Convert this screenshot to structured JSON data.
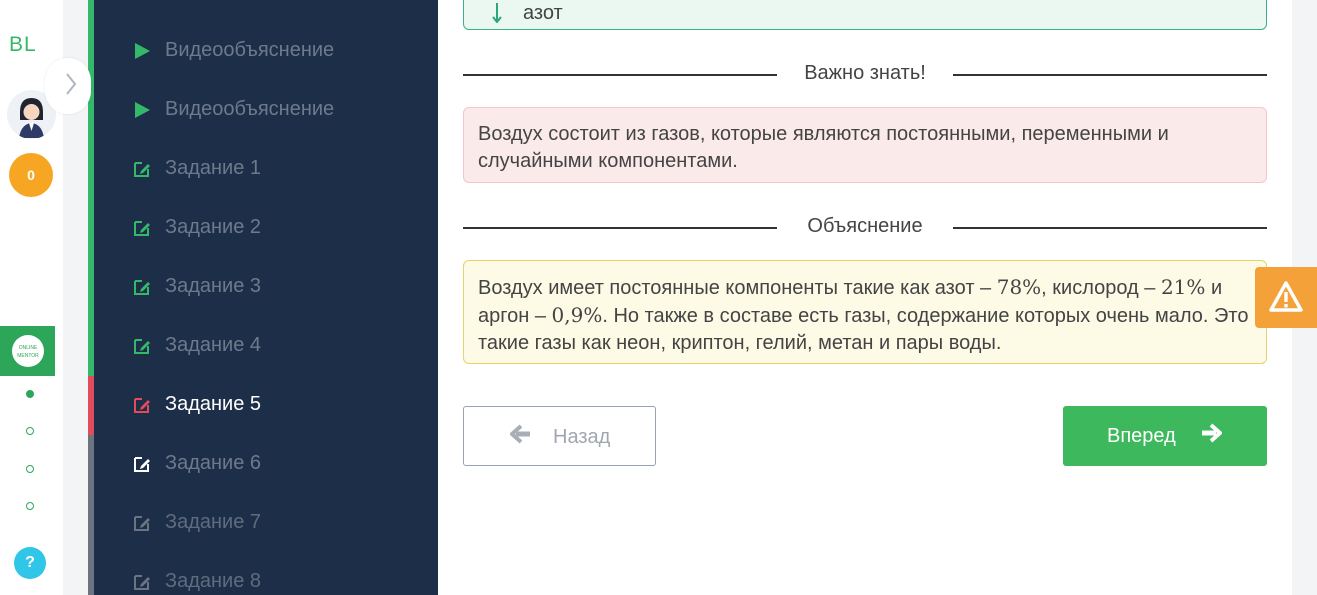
{
  "rail": {
    "logo": "BL",
    "coins": "0",
    "online_badge": "ONLINE MENTOR",
    "help": "?"
  },
  "sidebar": {
    "items": [
      {
        "label": "Видеообъяснение",
        "type": "video",
        "state": "done"
      },
      {
        "label": "Видеообъяснение",
        "type": "video",
        "state": "done"
      },
      {
        "label": "Задание 1",
        "type": "task",
        "state": "done"
      },
      {
        "label": "Задание 2",
        "type": "task",
        "state": "done"
      },
      {
        "label": "Задание 3",
        "type": "task",
        "state": "done"
      },
      {
        "label": "Задание 4",
        "type": "task",
        "state": "done"
      },
      {
        "label": "Задание 5",
        "type": "task",
        "state": "active"
      },
      {
        "label": "Задание 6",
        "type": "task",
        "state": "current"
      },
      {
        "label": "Задание 7",
        "type": "task",
        "state": "locked"
      },
      {
        "label": "Задание 8",
        "type": "task",
        "state": "locked"
      }
    ]
  },
  "main": {
    "answer_text": "азот",
    "important_title": "Важно знать!",
    "important_text": "Воздух состоит из газов, которые являются постоянными, переменными и случайными компонентами.",
    "explanation_title": "Объяснение",
    "explanation": {
      "p1": "Воздух имеет постоянные компоненты такие как азот – ",
      "v1": "78%",
      "p2": ", кислород – ",
      "v2": "21%",
      "p3": " и аргон – ",
      "v3": "0,9%",
      "p4": ". Но также в составе есть газы, содержание которых очень мало. Это такие газы как неон, криптон, гелий, метан и пары воды."
    },
    "back_label": "Назад",
    "next_label": "Вперед"
  },
  "colors": {
    "sidebar_bg": "#1d2f48",
    "accent_green": "#3db85c",
    "active_red": "#e24b5c",
    "warning_orange": "#f4a13a"
  }
}
